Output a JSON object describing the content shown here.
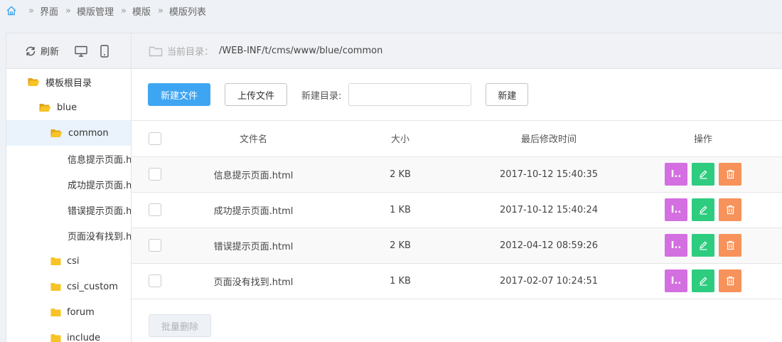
{
  "breadcrumb": [
    "界面",
    "模版管理",
    "模版",
    "模版列表"
  ],
  "left_toolbar": {
    "refresh_label": "刷新"
  },
  "tree": [
    {
      "label": "模板根目录",
      "type": "folder-open",
      "level": 0
    },
    {
      "label": "blue",
      "type": "folder-open",
      "level": 1
    },
    {
      "label": "common",
      "type": "folder-open",
      "level": 2,
      "selected": true
    },
    {
      "label": "信息提示页面.html",
      "type": "file",
      "level": 3
    },
    {
      "label": "成功提示页面.html",
      "type": "file",
      "level": 3
    },
    {
      "label": "错误提示页面.html",
      "type": "file",
      "level": 3
    },
    {
      "label": "页面没有找到.html",
      "type": "file",
      "level": 3
    },
    {
      "label": "csi",
      "type": "folder",
      "level": 2
    },
    {
      "label": "csi_custom",
      "type": "folder",
      "level": 2
    },
    {
      "label": "forum",
      "type": "folder",
      "level": 2
    },
    {
      "label": "include",
      "type": "folder",
      "level": 2
    }
  ],
  "path_bar": {
    "label": "当前目录：",
    "value": "/WEB-INF/t/cms/www/blue/common"
  },
  "actions": {
    "new_file": "新建文件",
    "upload": "上传文件",
    "new_dir_label": "新建目录:",
    "new_dir_value": "",
    "create": "新建"
  },
  "table": {
    "headers": {
      "name": "文件名",
      "size": "大小",
      "modified": "最后修改时间",
      "ops": "操作"
    },
    "rows": [
      {
        "name": "信息提示页面.html",
        "size": "2 KB",
        "modified": "2017-10-12 15:40:35"
      },
      {
        "name": "成功提示页面.html",
        "size": "1 KB",
        "modified": "2017-10-12 15:40:24"
      },
      {
        "name": "错误提示页面.html",
        "size": "2 KB",
        "modified": "2012-04-12 08:59:26"
      },
      {
        "name": "页面没有找到.html",
        "size": "1 KB",
        "modified": "2017-02-07 10:24:51"
      }
    ],
    "op_rename_glyph": "I.."
  },
  "batch_delete": "批量删除",
  "colors": {
    "primary": "#3ea5f2",
    "rename": "#d36fe0",
    "edit": "#2dcc7f",
    "delete": "#f6925a",
    "folder": "#f7c325"
  }
}
